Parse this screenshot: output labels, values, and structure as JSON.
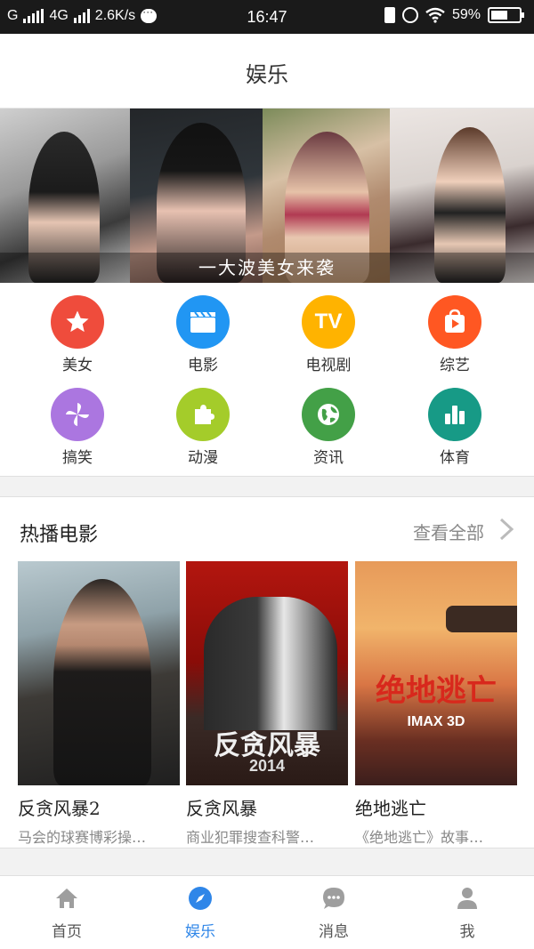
{
  "status_bar": {
    "carrier": "G",
    "network": "4G",
    "speed": "2.6K/s",
    "time": "16:47",
    "battery": "59%",
    "battery_level": 0.59
  },
  "header": {
    "title": "娱乐"
  },
  "banner": {
    "caption": "一大波美女来袭"
  },
  "categories": [
    {
      "label": "美女",
      "icon": "star-icon",
      "color": "#ef4c3c"
    },
    {
      "label": "电影",
      "icon": "clapperboard-icon",
      "color": "#2196f3"
    },
    {
      "label": "电视剧",
      "icon": "tv-icon",
      "color": "#ffb300"
    },
    {
      "label": "综艺",
      "icon": "play-bag-icon",
      "color": "#ff5722"
    },
    {
      "label": "搞笑",
      "icon": "pinwheel-icon",
      "color": "#ab76e0"
    },
    {
      "label": "动漫",
      "icon": "puzzle-icon",
      "color": "#a4cc2a"
    },
    {
      "label": "资讯",
      "icon": "globe-icon",
      "color": "#43a047"
    },
    {
      "label": "体育",
      "icon": "bar-chart-icon",
      "color": "#179a86"
    }
  ],
  "tv_badge": "TV",
  "hot_movies": {
    "title": "热播电影",
    "more": "查看全部",
    "items": [
      {
        "name": "反贪风暴2",
        "desc": "马会的球赛博彩操…"
      },
      {
        "name": "反贪风暴",
        "desc": "商业犯罪搜查科警…",
        "poster_text": "反贪风暴",
        "poster_year": "2014"
      },
      {
        "name": "绝地逃亡",
        "desc": "《绝地逃亡》故事…",
        "poster_text": "绝地逃亡",
        "poster_sub": "IMAX 3D"
      }
    ]
  },
  "bottom_nav": [
    {
      "label": "首页",
      "icon": "home-icon",
      "active": false
    },
    {
      "label": "娱乐",
      "icon": "compass-icon",
      "active": true
    },
    {
      "label": "消息",
      "icon": "chat-icon",
      "active": false
    },
    {
      "label": "我",
      "icon": "person-icon",
      "active": false
    }
  ],
  "colors": {
    "accent": "#2f86e8",
    "nav_inactive": "#9e9e9e"
  }
}
